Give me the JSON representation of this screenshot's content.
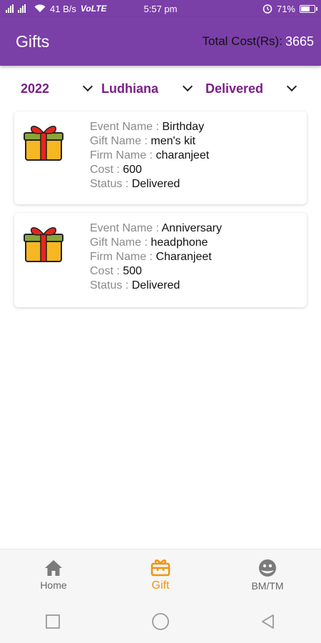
{
  "status_bar": {
    "network_speed": "41 B/s",
    "volte": "VoLTE",
    "time": "5:57 pm",
    "battery_percent": "71%",
    "battery_level": 0.71
  },
  "header": {
    "title": "Gifts",
    "total_cost_label": "Total Cost(Rs):",
    "total_cost_value": "3665"
  },
  "filters": {
    "year": "2022",
    "city": "Ludhiana",
    "status": "Delivered"
  },
  "labels": {
    "event_name": "Event Name : ",
    "gift_name": "Gift Name : ",
    "firm_name": "Firm Name : ",
    "cost": "Cost : ",
    "status": "Status : "
  },
  "gifts": [
    {
      "event_name": "Birthday",
      "gift_name": "men's kit",
      "firm_name": "charanjeet",
      "cost": "600",
      "status": "Delivered"
    },
    {
      "event_name": "Anniversary",
      "gift_name": "headphone",
      "firm_name": "Charanjeet",
      "cost": "500",
      "status": "Delivered"
    }
  ],
  "bottom_nav": {
    "items": [
      {
        "label": "Home",
        "icon": "home-icon"
      },
      {
        "label": "Gift",
        "icon": "gift-icon",
        "active": true
      },
      {
        "label": "BM/TM",
        "icon": "face-icon"
      }
    ]
  },
  "colors": {
    "primary": "#7b3fa8",
    "filter_text": "#7a1f86",
    "active_nav": "#f0930f"
  }
}
